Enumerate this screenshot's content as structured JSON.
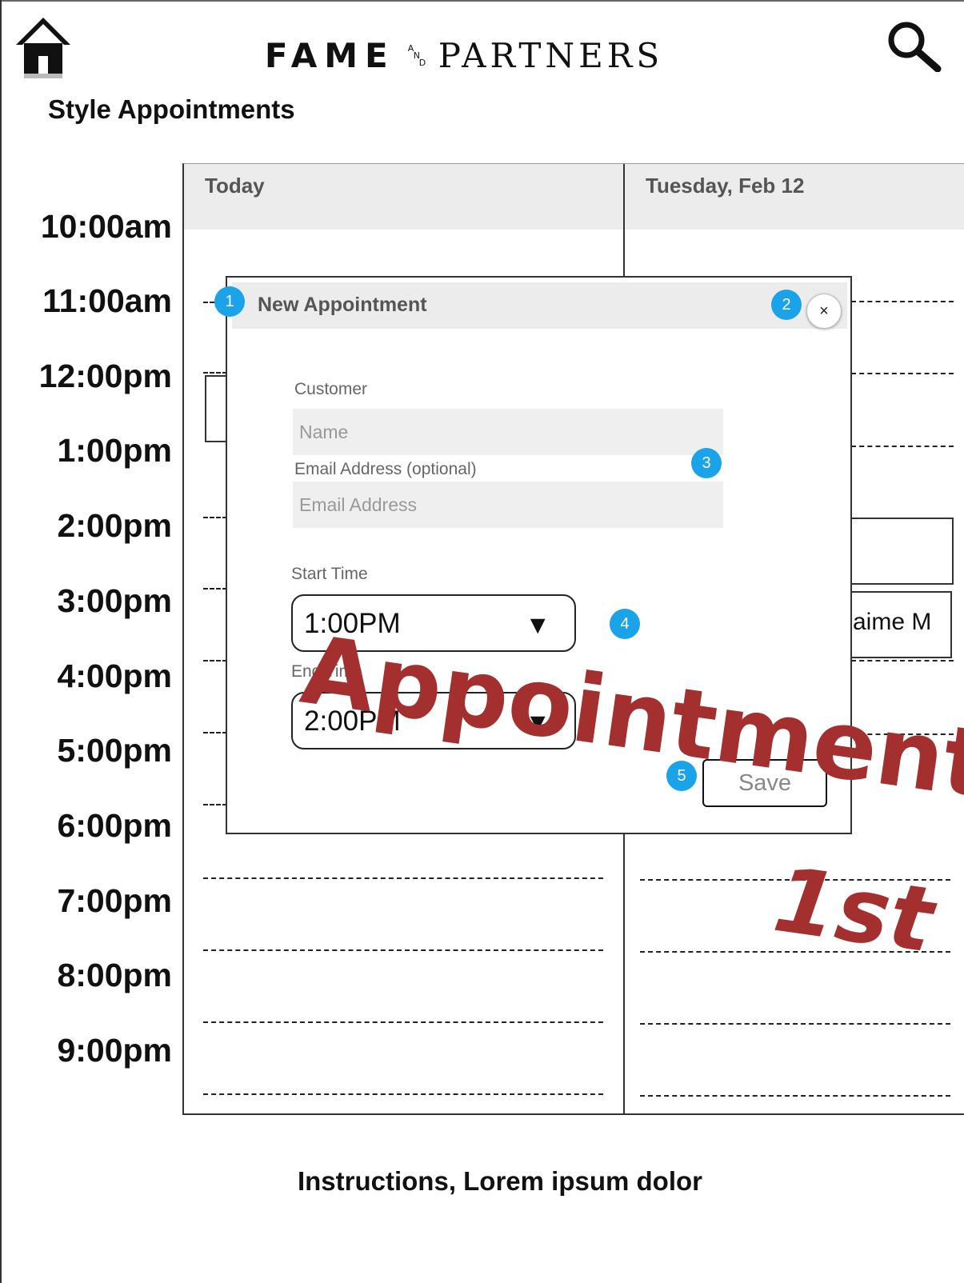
{
  "header": {
    "brand_main": "FAME",
    "brand_and_a": "A",
    "brand_and_n": "N",
    "brand_and_d": "D",
    "brand_partners": "PARTNERS",
    "home_icon": "home-icon",
    "search_icon": "search-icon"
  },
  "page": {
    "title": "Style Appointments",
    "instructions": "Instructions, Lorem ipsum dolor"
  },
  "calendar": {
    "columns": [
      "Today",
      "Tuesday, Feb 12"
    ],
    "times": [
      "10:00am",
      "11:00am",
      "12:00pm",
      "1:00pm",
      "2:00pm",
      "3:00pm",
      "4:00pm",
      "5:00pm",
      "6:00pm",
      "7:00pm",
      "8:00pm",
      "9:00pm"
    ],
    "booked_slot_text": "aime M"
  },
  "modal": {
    "title": "New Appointment",
    "close_label": "×",
    "customer_label": "Customer",
    "name_placeholder": "Name",
    "email_label": "Email Address (optional)",
    "email_placeholder": "Email Address",
    "start_label": "Start Time",
    "start_value": "1:00PM",
    "end_label": "End Time",
    "end_value": "2:00PM",
    "arrow": "▼",
    "save_label": "Save"
  },
  "badges": [
    "1",
    "2",
    "3",
    "4",
    "5"
  ],
  "overlay": {
    "line1": "Appointment",
    "line2": "1st"
  },
  "colors": {
    "badge": "#1aa3e8",
    "overlay": "#a3302f",
    "header_bg": "#ececec"
  }
}
